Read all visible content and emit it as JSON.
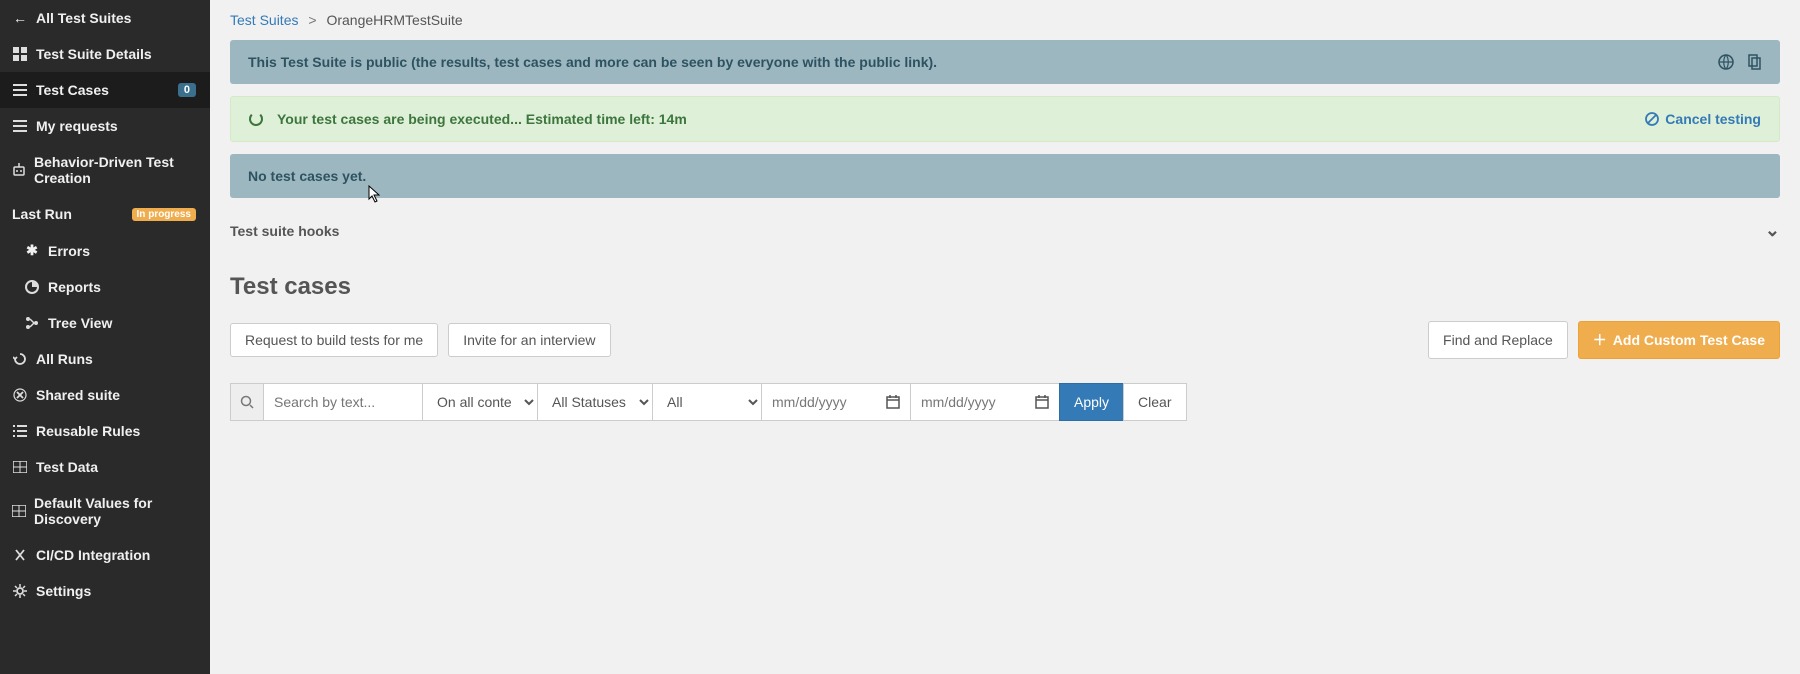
{
  "breadcrumb": {
    "root": "Test Suites",
    "current": "OrangeHRMTestSuite"
  },
  "sidebar": {
    "allSuites": "All Test Suites",
    "suiteDetails": "Test Suite Details",
    "testCases": "Test Cases",
    "testCasesCount": "0",
    "myRequests": "My requests",
    "behaviorDriven": "Behavior-Driven Test Creation",
    "lastRun": "Last Run",
    "lastRunBadge": "In progress",
    "errors": "Errors",
    "reports": "Reports",
    "treeView": "Tree View",
    "allRuns": "All Runs",
    "sharedSuite": "Shared suite",
    "reusableRules": "Reusable Rules",
    "testData": "Test Data",
    "defaultValues": "Default Values for Discovery",
    "cicd": "CI/CD Integration",
    "settings": "Settings"
  },
  "alerts": {
    "publicNotice": "This Test Suite is public (the results, test cases and more can be seen by everyone with the public link).",
    "executingMsg": "Your test cases are being executed... Estimated time left: 14m",
    "cancelTesting": "Cancel testing",
    "noCases": "No test cases yet."
  },
  "sections": {
    "hooksTitle": "Test suite hooks",
    "testCasesTitle": "Test cases"
  },
  "buttons": {
    "requestBuild": "Request to build tests for me",
    "inviteInterview": "Invite for an interview",
    "findReplace": "Find and Replace",
    "addCustom": "Add Custom Test Case",
    "apply": "Apply",
    "clear": "Clear"
  },
  "filters": {
    "searchPlaceholder": "Search by text...",
    "contentSelect": "On all content",
    "statusSelect": "All Statuses",
    "allSelect": "All",
    "datePlaceholder": "mm/dd/yyyy"
  }
}
